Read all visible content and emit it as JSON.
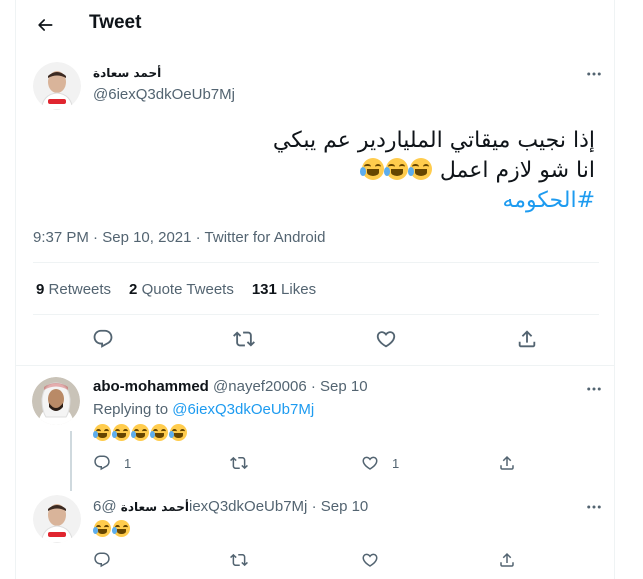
{
  "header": {
    "title": "Tweet"
  },
  "main_tweet": {
    "author_name": "أحمد سعادة",
    "author_handle": "@6iexQ3dkOeUb7Mj",
    "text_line1": "إذا نجيب ميقاتي الملياردير عم يبكي",
    "text_line2": "انا شو لازم اعمل",
    "hashtag": "#الحكومه",
    "time": "9:37 PM",
    "date": "Sep 10, 2021",
    "source": "Twitter for Android",
    "separator": "·",
    "retweets_count": "9",
    "retweets_label": "Retweets",
    "quotes_count": "2",
    "quotes_label": "Quote Tweets",
    "likes_count": "131",
    "likes_label": "Likes",
    "emoji_count": 3
  },
  "replies": [
    {
      "author_name": "abo-mohammed",
      "author_handle": "@nayef20006",
      "separator": "·",
      "date": "Sep 10",
      "replying_to_label": "Replying to",
      "replying_to_handle": "@6iexQ3dkOeUb7Mj",
      "emoji_count": 5,
      "reply_count": "1",
      "like_count": "1"
    },
    {
      "author_name": "أحمد سعادة",
      "author_handle": "@6iexQ3dkOeUb7Mj",
      "separator": "·",
      "date": "Sep 10",
      "emoji_count": 2
    }
  ],
  "icons": [
    "back-arrow-icon",
    "more-icon",
    "reply-icon",
    "retweet-icon",
    "like-icon",
    "share-icon",
    "face-with-tears-of-joy-emoji"
  ],
  "colors": {
    "accent": "#1d9bf0",
    "text": "#0f1419",
    "muted": "#536471",
    "divider": "#eff3f4"
  }
}
